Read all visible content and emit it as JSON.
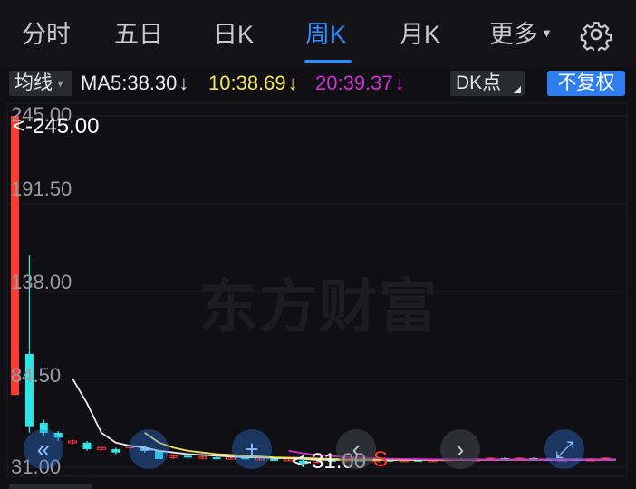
{
  "tabs": [
    {
      "label": "分时",
      "active": false
    },
    {
      "label": "五日",
      "active": false
    },
    {
      "label": "日K",
      "active": false
    },
    {
      "label": "周K",
      "active": true
    },
    {
      "label": "月K",
      "active": false
    },
    {
      "label": "更多",
      "active": false
    }
  ],
  "settings_icon": "gear-icon",
  "indicator_bar": {
    "average_type": "均线",
    "ma5": "MA5:38.30",
    "ma10": "10:38.69",
    "ma20": "20:39.37",
    "trend_arrow": "↓",
    "dk_label": "DK点",
    "adjust_label": "不复权"
  },
  "colors": {
    "accent": "#2f8cff",
    "ma5": "#e9e9ee",
    "ma10": "#f2e35a",
    "ma20": "#d22fd6",
    "up": "#ff3b30",
    "down": "#2ee6e6"
  },
  "chart": {
    "watermark": "东方财富",
    "high_label": "<-245.00",
    "low_label": "<-31.00",
    "low_marker": "S",
    "y_ticks": [
      "245.00",
      "191.50",
      "138.00",
      "84.50",
      "31.00"
    ],
    "ylim": [
      31.0,
      245.0
    ],
    "controls": [
      {
        "name": "scroll-left-icon",
        "glyph": "«"
      },
      {
        "name": "zoom-out-icon",
        "glyph": "−"
      },
      {
        "name": "zoom-in-icon",
        "glyph": "+"
      },
      {
        "name": "prev-icon",
        "glyph": "‹"
      },
      {
        "name": "next-icon",
        "glyph": "›"
      },
      {
        "name": "fullscreen-icon",
        "glyph": "⤢"
      }
    ]
  },
  "chart_data": {
    "type": "candlestick",
    "ylim": [
      31.0,
      245.0
    ],
    "candles": [
      {
        "open": 75,
        "close": 245,
        "high": 245,
        "low": 75,
        "dir": "up"
      },
      {
        "open": 100,
        "close": 56,
        "high": 160,
        "low": 52,
        "dir": "down"
      },
      {
        "open": 58,
        "close": 52,
        "high": 60,
        "low": 50,
        "dir": "down"
      },
      {
        "open": 52,
        "close": 49,
        "high": 53,
        "low": 47,
        "dir": "down"
      },
      {
        "open": 46,
        "close": 47,
        "high": 48,
        "low": 45,
        "dir": "up"
      },
      {
        "open": 46,
        "close": 42,
        "high": 47,
        "low": 41,
        "dir": "down"
      },
      {
        "open": 42,
        "close": 43,
        "high": 44,
        "low": 41,
        "dir": "up"
      },
      {
        "open": 42,
        "close": 40,
        "high": 43,
        "low": 39,
        "dir": "down"
      },
      {
        "open": 43,
        "close": 44,
        "high": 45,
        "low": 42,
        "dir": "up"
      },
      {
        "open": 43,
        "close": 41,
        "high": 44,
        "low": 40,
        "dir": "down"
      },
      {
        "open": 41,
        "close": 36,
        "high": 42,
        "low": 35,
        "dir": "down"
      },
      {
        "open": 37,
        "close": 38,
        "high": 39,
        "low": 36,
        "dir": "up"
      },
      {
        "open": 38,
        "close": 37,
        "high": 39,
        "low": 36,
        "dir": "down"
      },
      {
        "open": 37,
        "close": 37.5,
        "high": 38,
        "low": 36.5,
        "dir": "up"
      },
      {
        "open": 37,
        "close": 36.5,
        "high": 38,
        "low": 36,
        "dir": "down"
      },
      {
        "open": 36.5,
        "close": 37,
        "high": 37.5,
        "low": 36,
        "dir": "up"
      },
      {
        "open": 37,
        "close": 36,
        "high": 37.5,
        "low": 35.5,
        "dir": "down"
      },
      {
        "open": 36,
        "close": 36.5,
        "high": 37,
        "low": 35.5,
        "dir": "up"
      },
      {
        "open": 36,
        "close": 35.5,
        "high": 36.5,
        "low": 35,
        "dir": "down"
      },
      {
        "open": 35.5,
        "close": 36,
        "high": 36.5,
        "low": 35,
        "dir": "up"
      },
      {
        "open": 35,
        "close": 33,
        "high": 35.5,
        "low": 31,
        "dir": "down"
      },
      {
        "open": 34,
        "close": 35.5,
        "high": 36,
        "low": 33.5,
        "dir": "up"
      },
      {
        "open": 35.5,
        "close": 35,
        "high": 36,
        "low": 34.5,
        "dir": "down"
      },
      {
        "open": 35,
        "close": 35.5,
        "high": 36,
        "low": 34.5,
        "dir": "up"
      },
      {
        "open": 35.5,
        "close": 35,
        "high": 36,
        "low": 34.5,
        "dir": "down"
      },
      {
        "open": 35,
        "close": 35.5,
        "high": 36,
        "low": 34.5,
        "dir": "up"
      },
      {
        "open": 35.5,
        "close": 35,
        "high": 36,
        "low": 34.5,
        "dir": "down"
      },
      {
        "open": 35,
        "close": 35.5,
        "high": 36,
        "low": 34.5,
        "dir": "up"
      },
      {
        "open": 35.5,
        "close": 35,
        "high": 36,
        "low": 34.5,
        "dir": "down"
      },
      {
        "open": 35,
        "close": 35.5,
        "high": 36,
        "low": 34.5,
        "dir": "up"
      },
      {
        "open": 35.5,
        "close": 36,
        "high": 36.5,
        "low": 35,
        "dir": "up"
      },
      {
        "open": 36,
        "close": 35.5,
        "high": 36.5,
        "low": 35,
        "dir": "down"
      },
      {
        "open": 35.5,
        "close": 36,
        "high": 36.5,
        "low": 35,
        "dir": "up"
      },
      {
        "open": 36,
        "close": 36.5,
        "high": 37,
        "low": 35.5,
        "dir": "up"
      },
      {
        "open": 36.5,
        "close": 36,
        "high": 37,
        "low": 35.5,
        "dir": "down"
      },
      {
        "open": 36,
        "close": 36.5,
        "high": 37,
        "low": 35.5,
        "dir": "up"
      },
      {
        "open": 36.5,
        "close": 36,
        "high": 37,
        "low": 35.5,
        "dir": "down"
      },
      {
        "open": 36,
        "close": 35.5,
        "high": 36.5,
        "low": 35,
        "dir": "down"
      },
      {
        "open": 35.5,
        "close": 36,
        "high": 36.5,
        "low": 35,
        "dir": "up"
      },
      {
        "open": 36,
        "close": 35.5,
        "high": 36.5,
        "low": 35,
        "dir": "down"
      },
      {
        "open": 35.5,
        "close": 36,
        "high": 36.5,
        "low": 35,
        "dir": "up"
      },
      {
        "open": 36,
        "close": 36.5,
        "high": 37,
        "low": 35.5,
        "dir": "up"
      }
    ],
    "series": [
      {
        "name": "MA5",
        "color": "#e9e9ee",
        "values": [
          null,
          null,
          null,
          null,
          85,
          70,
          52,
          46,
          44,
          43,
          41,
          40,
          39,
          38.5,
          38,
          37.5,
          37,
          37,
          36.5,
          36.5,
          36,
          35.5,
          35.5,
          35.5,
          35.5,
          35.5,
          35.5,
          35.5,
          35.5,
          35.5,
          35.5,
          35.5,
          35.5,
          35.5,
          35.5,
          35.5,
          35.5,
          35.5,
          35.5,
          35.5,
          35.5,
          35.5
        ]
      },
      {
        "name": "10",
        "color": "#f2e35a",
        "values": [
          null,
          null,
          null,
          null,
          null,
          null,
          null,
          null,
          null,
          52,
          46,
          43,
          41,
          40,
          39,
          38.5,
          38,
          37.5,
          37,
          36.8,
          36.6,
          36.3,
          36,
          35.8,
          35.7,
          35.6,
          35.5,
          35.5,
          35.5,
          35.5,
          35.5,
          35.5,
          35.5,
          35.5,
          35.6,
          35.6,
          35.6,
          35.7,
          35.7,
          35.7,
          35.7,
          35.7
        ]
      },
      {
        "name": "20",
        "color": "#d22fd6",
        "values": [
          null,
          null,
          null,
          null,
          null,
          null,
          null,
          null,
          null,
          null,
          null,
          null,
          null,
          null,
          null,
          null,
          null,
          null,
          null,
          41,
          39.5,
          38.5,
          37.8,
          37.2,
          36.8,
          36.5,
          36.2,
          36,
          35.9,
          35.8,
          35.7,
          35.6,
          35.6,
          35.6,
          35.6,
          35.6,
          35.6,
          35.6,
          35.6,
          35.6,
          35.6,
          35.6
        ]
      }
    ]
  }
}
